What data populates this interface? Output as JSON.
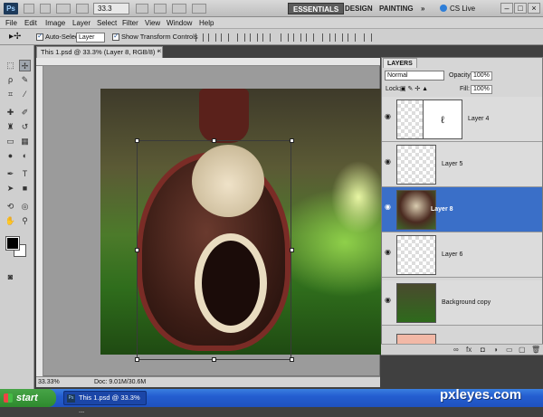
{
  "app": {
    "logo": "Ps",
    "zoom": "33.3",
    "workspaces": [
      "ESSENTIALS",
      "DESIGN",
      "PAINTING"
    ],
    "more": "»",
    "cs_live": "CS Live",
    "window_controls": [
      "–",
      "□",
      "×"
    ]
  },
  "menu": [
    "File",
    "Edit",
    "Image",
    "Layer",
    "Select",
    "Filter",
    "View",
    "Window",
    "Help"
  ],
  "options": {
    "auto_select_label": "Auto-Select:",
    "auto_select_value": "Layer",
    "transform_label": "Show Transform Controls"
  },
  "document": {
    "tab_title": "This 1.psd @ 33.3% (Layer 8, RGB/8) *",
    "close": "×",
    "status_zoom": "33.33%",
    "status_doc": "Doc: 9.01M/30.6M"
  },
  "layers_panel": {
    "tab": "LAYERS",
    "blend_mode": "Normal",
    "opacity_label": "Opacity:",
    "opacity": "100%",
    "lock_label": "Lock:",
    "fill_label": "Fill:",
    "fill": "100%",
    "layers": [
      {
        "name": "Layer 4",
        "thumb": "transparent",
        "mask": true,
        "selected": false
      },
      {
        "name": "Layer 5",
        "thumb": "transparent",
        "selected": false
      },
      {
        "name": "Layer 8",
        "thumb": "monkey",
        "selected": true
      },
      {
        "name": "Layer 6",
        "thumb": "transparent",
        "selected": false
      },
      {
        "name": "Background copy",
        "thumb": "photo",
        "selected": false
      }
    ],
    "footer_icons": [
      "link-icon",
      "fx-icon",
      "mask-icon",
      "adjustment-icon",
      "folder-icon",
      "new-layer-icon",
      "trash-icon"
    ]
  },
  "taskbar": {
    "start": "start",
    "task_title": "This 1.psd @ 33.3% ...",
    "watermark": "pxleyes.com"
  },
  "colors": {
    "selected_layer": "#3a6fc8",
    "taskbar": "#245ed0",
    "start": "#2e8a2e"
  }
}
